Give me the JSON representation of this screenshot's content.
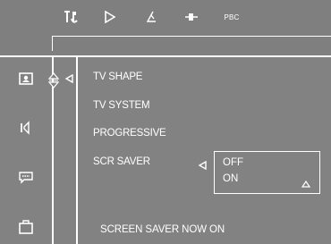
{
  "toolbar": {
    "items": [
      {
        "icon": "tools-icon"
      },
      {
        "icon": "play-icon"
      },
      {
        "icon": "signal-icon"
      },
      {
        "icon": "audio-icon"
      },
      {
        "icon_label": "PBC"
      }
    ]
  },
  "sidebar": {
    "items": [
      {
        "icon": "picture-icon"
      },
      {
        "icon": "speaker-icon"
      },
      {
        "icon": "subtitle-icon"
      },
      {
        "icon": "briefcase-icon"
      }
    ]
  },
  "menu": {
    "items": [
      {
        "label": "TV SHAPE"
      },
      {
        "label": "TV SYSTEM"
      },
      {
        "label": "PROGRESSIVE"
      },
      {
        "label": "SCR SAVER",
        "selected": true
      }
    ]
  },
  "submenu": {
    "options": [
      "OFF",
      "ON"
    ],
    "selected": "ON"
  },
  "status": {
    "text": "SCREEN SAVER NOW ON"
  },
  "colors": {
    "background": "#828282",
    "foreground": "#ffffff"
  }
}
